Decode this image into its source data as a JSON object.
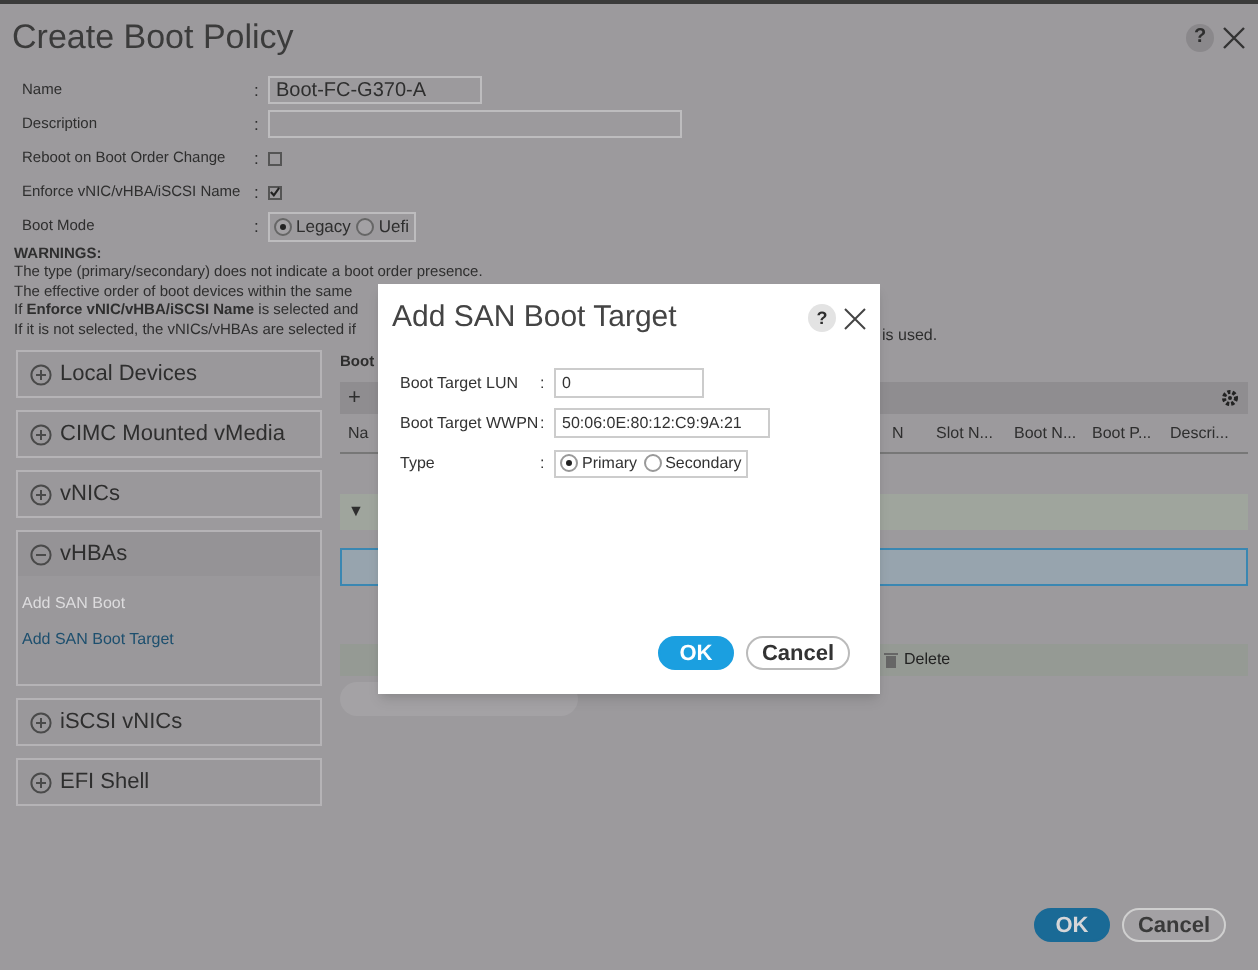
{
  "window": {
    "title": "Create Boot Policy"
  },
  "form": [
    {
      "kind": "text",
      "label": "Name",
      "colon": ":",
      "value": "Boot-FC-G370-A"
    },
    {
      "kind": "textwide",
      "label": "Description",
      "colon": ":"
    },
    {
      "kind": "checkbox",
      "label": "Reboot on Boot Order Change",
      "colon": ":",
      "checked": false
    },
    {
      "kind": "checkbox",
      "label": "Enforce vNIC/vHBA/iSCSI Name",
      "colon": ":",
      "checked": true
    },
    {
      "kind": "radio",
      "label": "Boot Mode",
      "colon": ":",
      "options": [
        {
          "label": "Legacy",
          "selected": true
        },
        {
          "label": "Uefi",
          "selected": false
        }
      ]
    }
  ],
  "warnings": {
    "title": "WARNINGS:",
    "lines": [
      "The type (primary/secondary) does not indicate a boot order presence.",
      "The effective order of boot devices within the same",
      "If **Enforce vNIC/vHBA/iSCSI Name** is selected and",
      "If it is not selected, the vNICs/vHBAs are selected if"
    ],
    "tail": "is used."
  },
  "sections": [
    {
      "label": "Local Devices",
      "expanded": false
    },
    {
      "label": "CIMC Mounted vMedia",
      "expanded": false
    },
    {
      "label": "vNICs",
      "expanded": false
    },
    {
      "label": "vHBAs",
      "expanded": true,
      "items": [
        {
          "label": "Add SAN Boot",
          "disabled": true
        },
        {
          "label": "Add SAN Boot Target",
          "disabled": false
        }
      ]
    },
    {
      "label": "iSCSI vNICs",
      "expanded": false
    },
    {
      "label": "EFI Shell",
      "expanded": false
    }
  ],
  "boot_order": {
    "title": "Boot",
    "add": "+",
    "columns": [
      "Na",
      "N",
      "Slot N...",
      "Boot N...",
      "Boot P...",
      "Descri..."
    ],
    "expander": "▼",
    "actions": [
      {
        "label": "Delete",
        "disabled": false
      }
    ]
  },
  "buttons": [
    {
      "label": "OK",
      "kind": "primary"
    },
    {
      "label": "Cancel",
      "kind": "secondary"
    }
  ],
  "dialog": {
    "title": "Add SAN Boot Target",
    "help": "?",
    "fields": [
      {
        "kind": "text",
        "label": "Boot Target LUN",
        "colon": ":",
        "value": "0"
      },
      {
        "kind": "text",
        "label": "Boot Target WWPN",
        "colon": ":",
        "value": "50:06:0E:80:12:C9:9A:21"
      },
      {
        "kind": "radio",
        "label": "Type",
        "colon": ":",
        "options": [
          {
            "label": "Primary",
            "selected": true
          },
          {
            "label": "Secondary",
            "selected": false
          }
        ]
      }
    ],
    "buttons": [
      {
        "label": "OK",
        "kind": "primary"
      },
      {
        "label": "Cancel",
        "kind": "secondary"
      }
    ]
  },
  "help": "?"
}
